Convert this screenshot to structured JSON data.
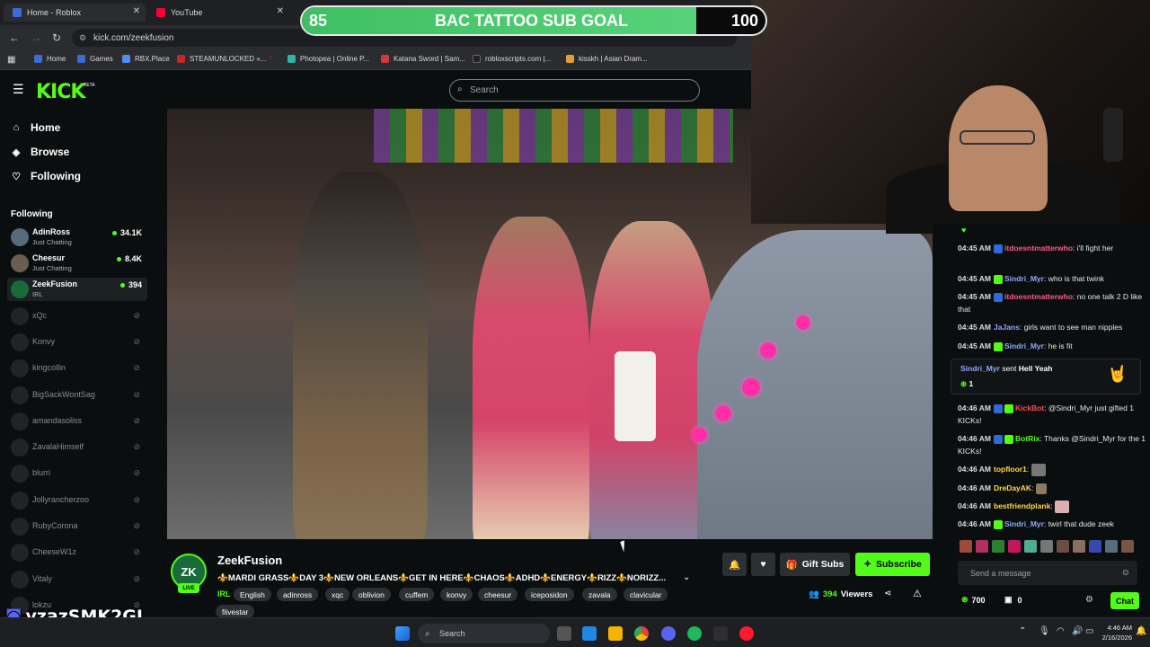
{
  "browser": {
    "tabs": [
      {
        "title": "Home - Roblox",
        "favicon_color": "#3a6bd6"
      },
      {
        "title": "YouTube",
        "favicon_color": "#ff0033"
      }
    ],
    "url": "kick.com/zeekfusion",
    "bookmarks": [
      "Home",
      "Games",
      "RBX.Place",
      "STEAMUNLOCKED »...",
      "Photopea | Online P...",
      "Katana Sword | Sam...",
      "robloxscripts.com |...",
      "kisskh | Asian Dram..."
    ]
  },
  "goal": {
    "start": "85",
    "title": "BAC TATTOO SUB GOAL",
    "end": "100",
    "progress_fraction": 0.85,
    "fill_color": "#53fc18"
  },
  "header": {
    "logo": "KICK",
    "beta": "BETA",
    "search_placeholder": "Search"
  },
  "sidebar": {
    "nav": [
      {
        "label": "Home",
        "icon": "home-icon"
      },
      {
        "label": "Browse",
        "icon": "compass-icon"
      },
      {
        "label": "Following",
        "icon": "heart-icon"
      }
    ],
    "following_heading": "Following",
    "live": [
      {
        "name": "AdinRoss",
        "category": "Just Chatting",
        "viewers": "34.1K"
      },
      {
        "name": "Cheesur",
        "category": "Just Chatting",
        "viewers": "8.4K"
      },
      {
        "name": "ZeekFusion",
        "category": "IRL",
        "viewers": "394"
      }
    ],
    "offline": [
      "xQc",
      "Konvy",
      "kingcollin",
      "BigSackWontSag",
      "amandasoliss",
      "ZavalaHimself",
      "blurri",
      "Jollyrancherzoo",
      "RubyCorona",
      "CheeseW1z",
      "Vitaly",
      "lokzu"
    ]
  },
  "stream": {
    "channel": "ZeekFusion",
    "live_badge": "LIVE",
    "title": "⚜️MARDI GRASS⚜️DAY 3⚜️NEW ORLEANS⚜️GET IN HERE⚜️CHAOS⚜️ADHD⚜️ENERGY⚜️RIZZ⚜️NORIZZ...",
    "category": "IRL",
    "tags": [
      "English",
      "adinross",
      "xqc",
      "oblivion",
      "cuffem",
      "konvy",
      "cheesur",
      "iceposidon",
      "zavala",
      "clavicular",
      "fiivestar"
    ],
    "gift_label": "Gift Subs",
    "subscribe_label": "Subscribe",
    "viewers": "394",
    "viewers_label": "Viewers"
  },
  "chat": {
    "messages": [
      {
        "time": "04:45 AM",
        "user": "itdoesntmatterwho",
        "color": "#ff5a8a",
        "text": "i'll fight her"
      },
      {
        "time": "04:45 AM",
        "user": "Sindri_Myr",
        "color": "#8ea8ff",
        "text": "who is that twink"
      },
      {
        "time": "04:45 AM",
        "user": "itdoesntmatterwho",
        "color": "#ff5a8a",
        "text": "no one talk 2 D like that"
      },
      {
        "time": "04:45 AM",
        "user": "JaJans",
        "color": "#8ea8ff",
        "text": "girls want to see man nipples"
      },
      {
        "time": "04:45 AM",
        "user": "Sindri_Myr",
        "color": "#8ea8ff",
        "text": "he is fit"
      }
    ],
    "gift_event": {
      "user": "Sindri_Myr",
      "text": "sent",
      "item": "Hell Yeah",
      "count": "1"
    },
    "messages2": [
      {
        "time": "04:46 AM",
        "user": "KickBot",
        "color": "#ff4d4d",
        "text": "@Sindri_Myr just gifted 1 KICKs!"
      },
      {
        "time": "04:46 AM",
        "user": "BotRix",
        "color": "#53fc18",
        "text": "Thanks @Sindri_Myr for the 1 KICKs!"
      },
      {
        "time": "04:46 AM",
        "user": "topfloor1",
        "color": "#ffd84a",
        "text": ""
      },
      {
        "time": "04:46 AM",
        "user": "DreDayAK",
        "color": "#ffd84a",
        "text": ""
      },
      {
        "time": "04:46 AM",
        "user": "bestfriendplank",
        "color": "#ffd84a",
        "text": ""
      },
      {
        "time": "04:46 AM",
        "user": "Sindri_Myr",
        "color": "#8ea8ff",
        "text": "twirl that dude zeek"
      }
    ],
    "send_placeholder": "Send a message",
    "kicks": "700",
    "points": "0",
    "chat_button": "Chat"
  },
  "overlay": {
    "username": "vzazSMK2GJ"
  },
  "taskbar": {
    "search": "Search",
    "time": "4:46 AM",
    "date": "2/16/2026"
  }
}
